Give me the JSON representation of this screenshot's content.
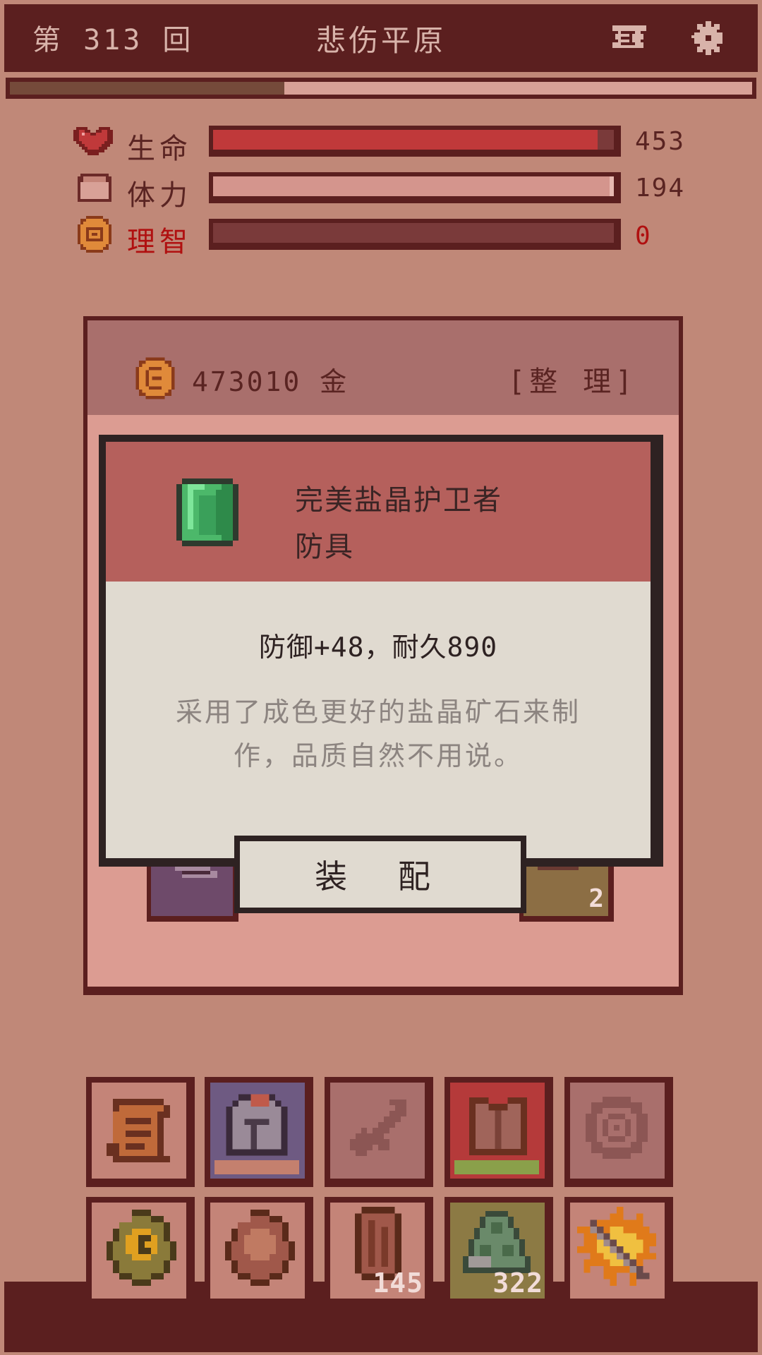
{
  "header": {
    "round_label": "第 313 回",
    "location": "悲伤平原",
    "progress_fraction": 0.37,
    "map_icon": "map-icon",
    "settings_icon": "gear-icon"
  },
  "stats": [
    {
      "label": "生命",
      "value": "453",
      "fraction": 0.96,
      "color": "#c0393a",
      "icon": "heart-icon"
    },
    {
      "label": "体力",
      "value": "194",
      "fraction": 0.99,
      "color": "#d4958d",
      "icon": "stamina-icon"
    },
    {
      "label": "理智",
      "value": "0",
      "fraction": 0.0,
      "color": "#7a3a3a",
      "icon": "sanity-icon",
      "label_color": "#b01010"
    }
  ],
  "inventory": {
    "gold_text": "473010 金",
    "sort_label": "[整 理]",
    "peek_count": "2"
  },
  "item_popup": {
    "name": "完美盐晶护卫者",
    "type": "防具",
    "stats": "防御+48，耐久890",
    "description": "采用了成色更好的盐晶矿石来制作，品质自然不用说。",
    "equip_label": "装 配",
    "icon": "salt-crystal-armor-icon"
  },
  "bottom_slots": [
    {
      "icon": "scroll-icon",
      "count": ""
    },
    {
      "icon": "helmet-icon",
      "count": ""
    },
    {
      "icon": "sword-icon",
      "count": ""
    },
    {
      "icon": "armor-icon",
      "count": ""
    },
    {
      "icon": "amulet-icon",
      "count": ""
    },
    {
      "icon": "spellbook-icon",
      "count": ""
    },
    {
      "icon": "book-icon",
      "count": ""
    },
    {
      "icon": "meat-icon",
      "count": "145"
    },
    {
      "icon": "ore-icon",
      "count": "322"
    },
    {
      "icon": "fire-skill-icon",
      "count": ""
    }
  ]
}
